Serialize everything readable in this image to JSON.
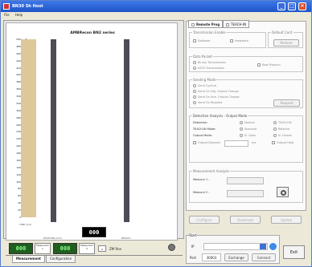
{
  "window": {
    "title": "BN30 Sh Host"
  },
  "menu": {
    "file": "File",
    "help": "Help"
  },
  "plot": {
    "title": "AMBRecon BN2 series",
    "ticks": [
      "500",
      "480",
      "460",
      "440",
      "420",
      "400",
      "380",
      "360",
      "340",
      "320",
      "300",
      "280",
      "260",
      "240",
      "220",
      "200",
      "180",
      "160",
      "140",
      "120",
      "100",
      "80",
      "60",
      "40",
      "20",
      "0"
    ],
    "xlabels": [
      "TIME (ms)",
      "POSITION (mm)",
      "RESULT"
    ]
  },
  "bottom": {
    "measure1": "000",
    "measure1_label": "Measurem 1",
    "measure2": "000",
    "measure2_label": "Measurem 2",
    "black_value": "000",
    "digit_val": "0",
    "tabs": [
      "Measurement",
      "Configuration"
    ],
    "speed_label": "ZM fine"
  },
  "right": {
    "tabs": [
      "Remote Prog",
      "TEACH-IN"
    ],
    "transmission": {
      "label": "Transmission Enable",
      "software": "Software",
      "hardware": "Hardware"
    },
    "default_conf": {
      "label": "Default Conf.",
      "button": "Restore"
    },
    "data_packet": {
      "label": "Data Packet",
      "binary": "Binary Transmission",
      "ascii": "ASCII Transmission",
      "raw": "Raw Protocol"
    },
    "sending": {
      "label": "Sending Mode",
      "opts": [
        "Send Cyclical",
        "Send On Dig. Output Change",
        "Send On Ana. Output Change",
        "Send On Request"
      ],
      "button": "Request"
    },
    "detection": {
      "label": "Detection Analysis - Output Mode",
      "detection": "Detection:",
      "teach": "TEACH-IN Mode:",
      "output": "Output Mode:",
      "normal": "Normal",
      "teach_in": "TEACH-IN",
      "absolute": "Absolute",
      "relative": "Relative",
      "n_open": "N. Open",
      "n_closed": "N. Closed",
      "output_delayed": "Output Delayed",
      "ms": "ms",
      "output_hold": "Output Hold"
    },
    "measurement": {
      "label": "Measurement Analysis",
      "m1": "Measure 1 :",
      "m2": "Measure 2 :"
    },
    "buttons": [
      "Configure",
      "Download",
      "Upload"
    ]
  },
  "start": {
    "label": "Start",
    "ip": "IP",
    "port_label": "Port",
    "port_value": "30003",
    "exchange": "Exchange",
    "connect": "Connect",
    "exit": "Exit"
  }
}
